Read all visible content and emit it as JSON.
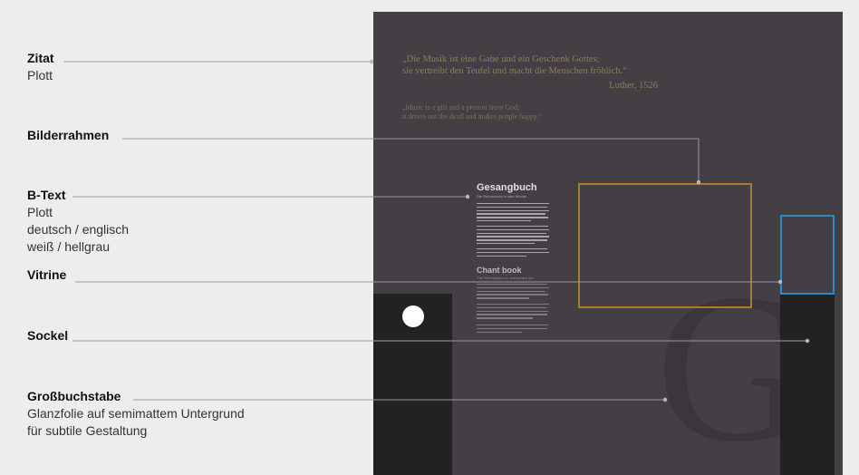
{
  "labels": {
    "zitat": {
      "title": "Zitat",
      "lines": [
        "Plott"
      ]
    },
    "bilderrahmen": {
      "title": "Bilderrahmen"
    },
    "btext": {
      "title": "B-Text",
      "lines": [
        "Plott",
        "deutsch / englisch",
        "weiß / hellgrau"
      ]
    },
    "vitrine": {
      "title": "Vitrine"
    },
    "sockel": {
      "title": "Sockel"
    },
    "grossbuchstabe": {
      "title": "Großbuchstabe",
      "lines": [
        "Glanzfolie auf semimattem Untergrund",
        "für subtile Gestaltung"
      ]
    }
  },
  "panel": {
    "quote_de": [
      "„Die Musik ist eine Gabe und ein Geschenk Gottes;",
      "sie vertreibt den Teufel und macht die Menschen fröhlich.“"
    ],
    "quote_author": "Luther, 1526",
    "quote_en": [
      "„Music is a gift and a present from God;",
      "it drives out the devil and makes people happy.“"
    ],
    "btext_title_de": "Gesangbuch",
    "btext_sub_de": "Die Reformation in aller Munde",
    "btext_title_en": "Chant book",
    "btext_sub_en": "The Reformation on everyone's lips",
    "big_letter": "G"
  },
  "colors": {
    "panel_bg": "#433f45",
    "pedestal": "#232223",
    "frame": "#a87e2e",
    "vitrine": "#2e8ac6",
    "quote": "#8d7d57",
    "leader_line": "#9a9a9a",
    "page_bg": "#ededed"
  }
}
